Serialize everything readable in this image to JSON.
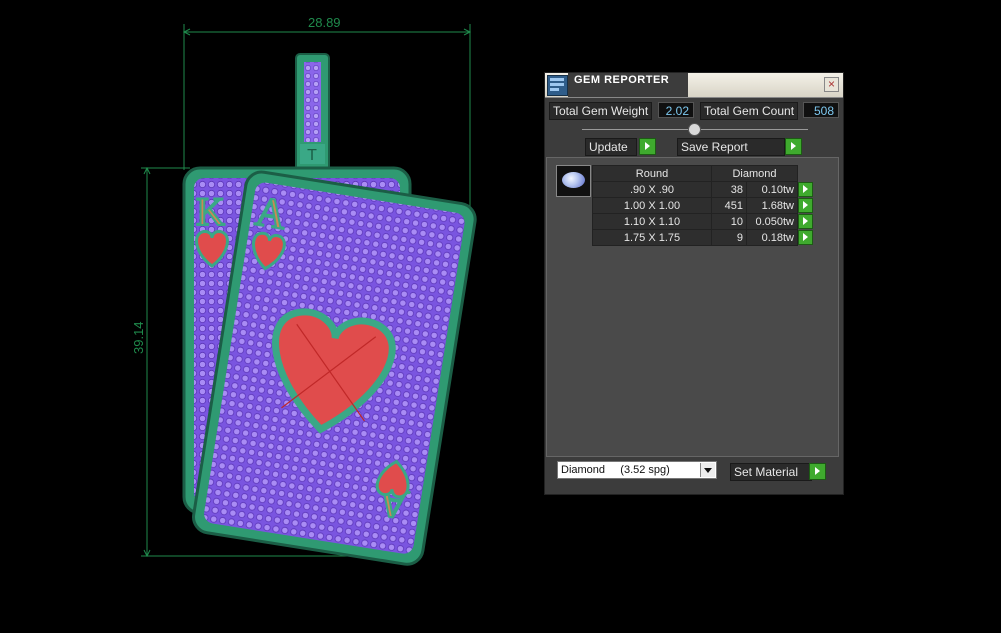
{
  "viewport": {
    "dimension_width": "28.89",
    "dimension_height": "39.14"
  },
  "panel": {
    "title": "GEM REPORTER",
    "close_label": "×",
    "total_gem_weight_label": "Total Gem Weight",
    "total_gem_weight_value": "2.02",
    "total_gem_count_label": "Total Gem Count",
    "total_gem_count_value": "508",
    "update_label": "Update",
    "save_report_label": "Save Report",
    "table": {
      "shape_header": "Round",
      "material_header": "Diamond",
      "rows": [
        {
          "size": ".90 X .90",
          "count": "38",
          "weight": "0.10tw"
        },
        {
          "size": "1.00 X 1.00",
          "count": "451",
          "weight": "1.68tw"
        },
        {
          "size": "1.10 X 1.10",
          "count": "10",
          "weight": "0.050tw"
        },
        {
          "size": "1.75 X 1.75",
          "count": "9",
          "weight": "0.18tw"
        }
      ]
    },
    "material_select_value": "Diamond     (3.52 spg)",
    "set_material_label": "Set Material"
  },
  "colors": {
    "dimension_lines": "#1f8a4c",
    "pendant_metal": "#2f9a72",
    "gem_field": "#8a5ce8",
    "heart_red": "#e04c4c",
    "value_text": "#7ec9f0",
    "action_green": "#3faa2e"
  }
}
